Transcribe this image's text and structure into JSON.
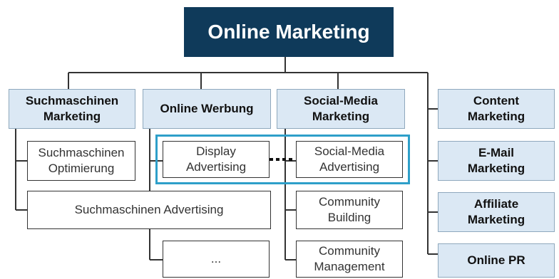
{
  "root": {
    "label": "Online Marketing"
  },
  "categories": [
    {
      "label": "Suchmaschinen\nMarketing"
    },
    {
      "label": "Online Werbung"
    },
    {
      "label": "Social-Media\nMarketing"
    },
    {
      "label": "Content\nMarketing"
    },
    {
      "label": "E-Mail\nMarketing"
    },
    {
      "label": "Affiliate\nMarketing"
    },
    {
      "label": "Online PR"
    }
  ],
  "subitems": {
    "seo": "Suchmaschinen\nOptimierung",
    "display": "Display\nAdvertising",
    "social_ads": "Social-Media\nAdvertising",
    "sea": "Suchmaschinen Advertising",
    "ellipsis": "...",
    "community_building": "Community\nBuilding",
    "community_management": "Community\nManagement"
  },
  "colors": {
    "root_fill": "#0f3a5a",
    "category_fill": "#dbe8f4",
    "highlight_border": "#2e9fc9"
  }
}
